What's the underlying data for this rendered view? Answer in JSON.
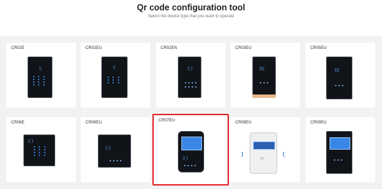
{
  "header": {
    "title": "Qr code configuration tool",
    "subtitle": "Select the device type that you want to operate"
  },
  "devices": [
    {
      "label": "CR02E",
      "selected": false
    },
    {
      "label": "CR02EU",
      "selected": false
    },
    {
      "label": "CR02EN",
      "selected": false
    },
    {
      "label": "CR03EU",
      "selected": false
    },
    {
      "label": "CR05EU",
      "selected": false
    },
    {
      "label": "CR06E",
      "selected": false
    },
    {
      "label": "CR06EU",
      "selected": false
    },
    {
      "label": "CR07EU",
      "selected": true
    },
    {
      "label": "CR08EU",
      "selected": false
    },
    {
      "label": "CR09EU",
      "selected": false
    }
  ],
  "colors": {
    "selection_border": "#e0262b",
    "keypad_glow": "#3f8df0",
    "background": "#f2f2f2"
  }
}
